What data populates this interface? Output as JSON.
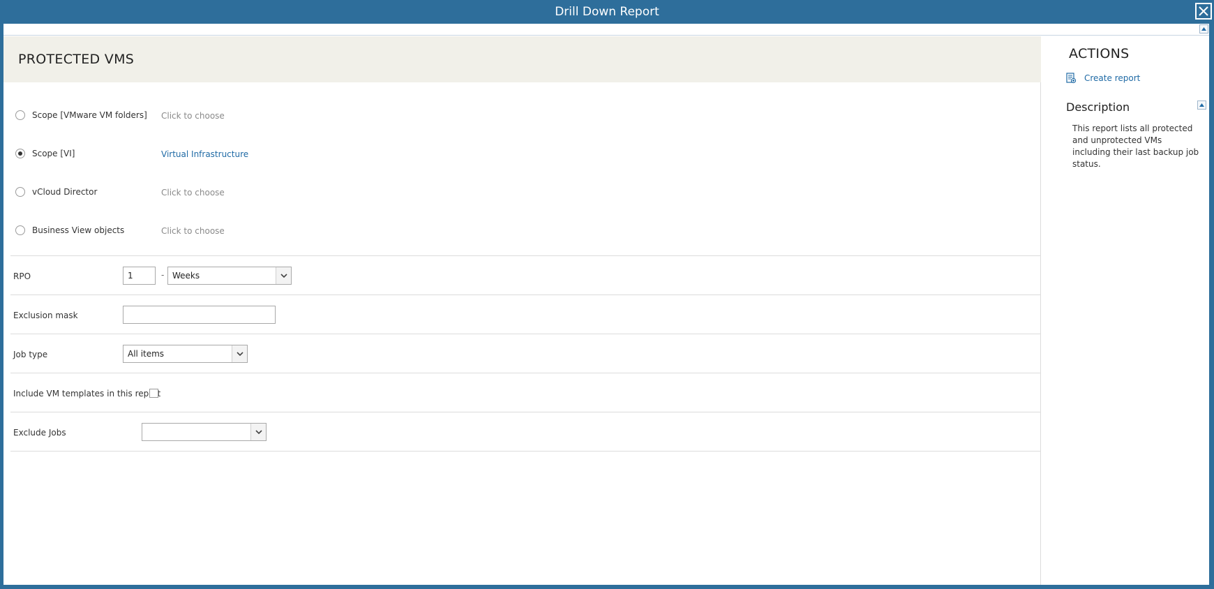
{
  "window": {
    "title": "Drill Down Report"
  },
  "panel": {
    "title": "PROTECTED VMS"
  },
  "scope_options": [
    {
      "label": "Scope [VMware VM folders]",
      "value": "Click to choose",
      "selected": false
    },
    {
      "label": "Scope [VI]",
      "value": "Virtual Infrastructure",
      "selected": true
    },
    {
      "label": "vCloud Director",
      "value": "Click to choose",
      "selected": false
    },
    {
      "label": "Business View objects",
      "value": "Click to choose",
      "selected": false
    }
  ],
  "rpo": {
    "label": "RPO",
    "value": "1",
    "separator": "-",
    "unit": "Weeks"
  },
  "exclusion_mask": {
    "label": "Exclusion mask",
    "value": ""
  },
  "job_type": {
    "label": "Job type",
    "value": "All items"
  },
  "include_templates": {
    "label": "Include VM templates in this report",
    "checked": false
  },
  "exclude_jobs": {
    "label": "Exclude Jobs",
    "value": ""
  },
  "sidebar": {
    "actions_heading": "ACTIONS",
    "create_report_label": "Create report",
    "description_heading": "Description",
    "description_text": "This report lists all protected and unprotected VMs including their last backup job status."
  },
  "colors": {
    "titlebar": "#2e6e9b",
    "header_bg": "#f1f0e9",
    "link": "#1f6aa5"
  },
  "icons": {
    "close": "close-icon",
    "collapse": "chevron-up-icon",
    "create_report": "report-icon",
    "dropdown": "chevron-down-icon"
  }
}
